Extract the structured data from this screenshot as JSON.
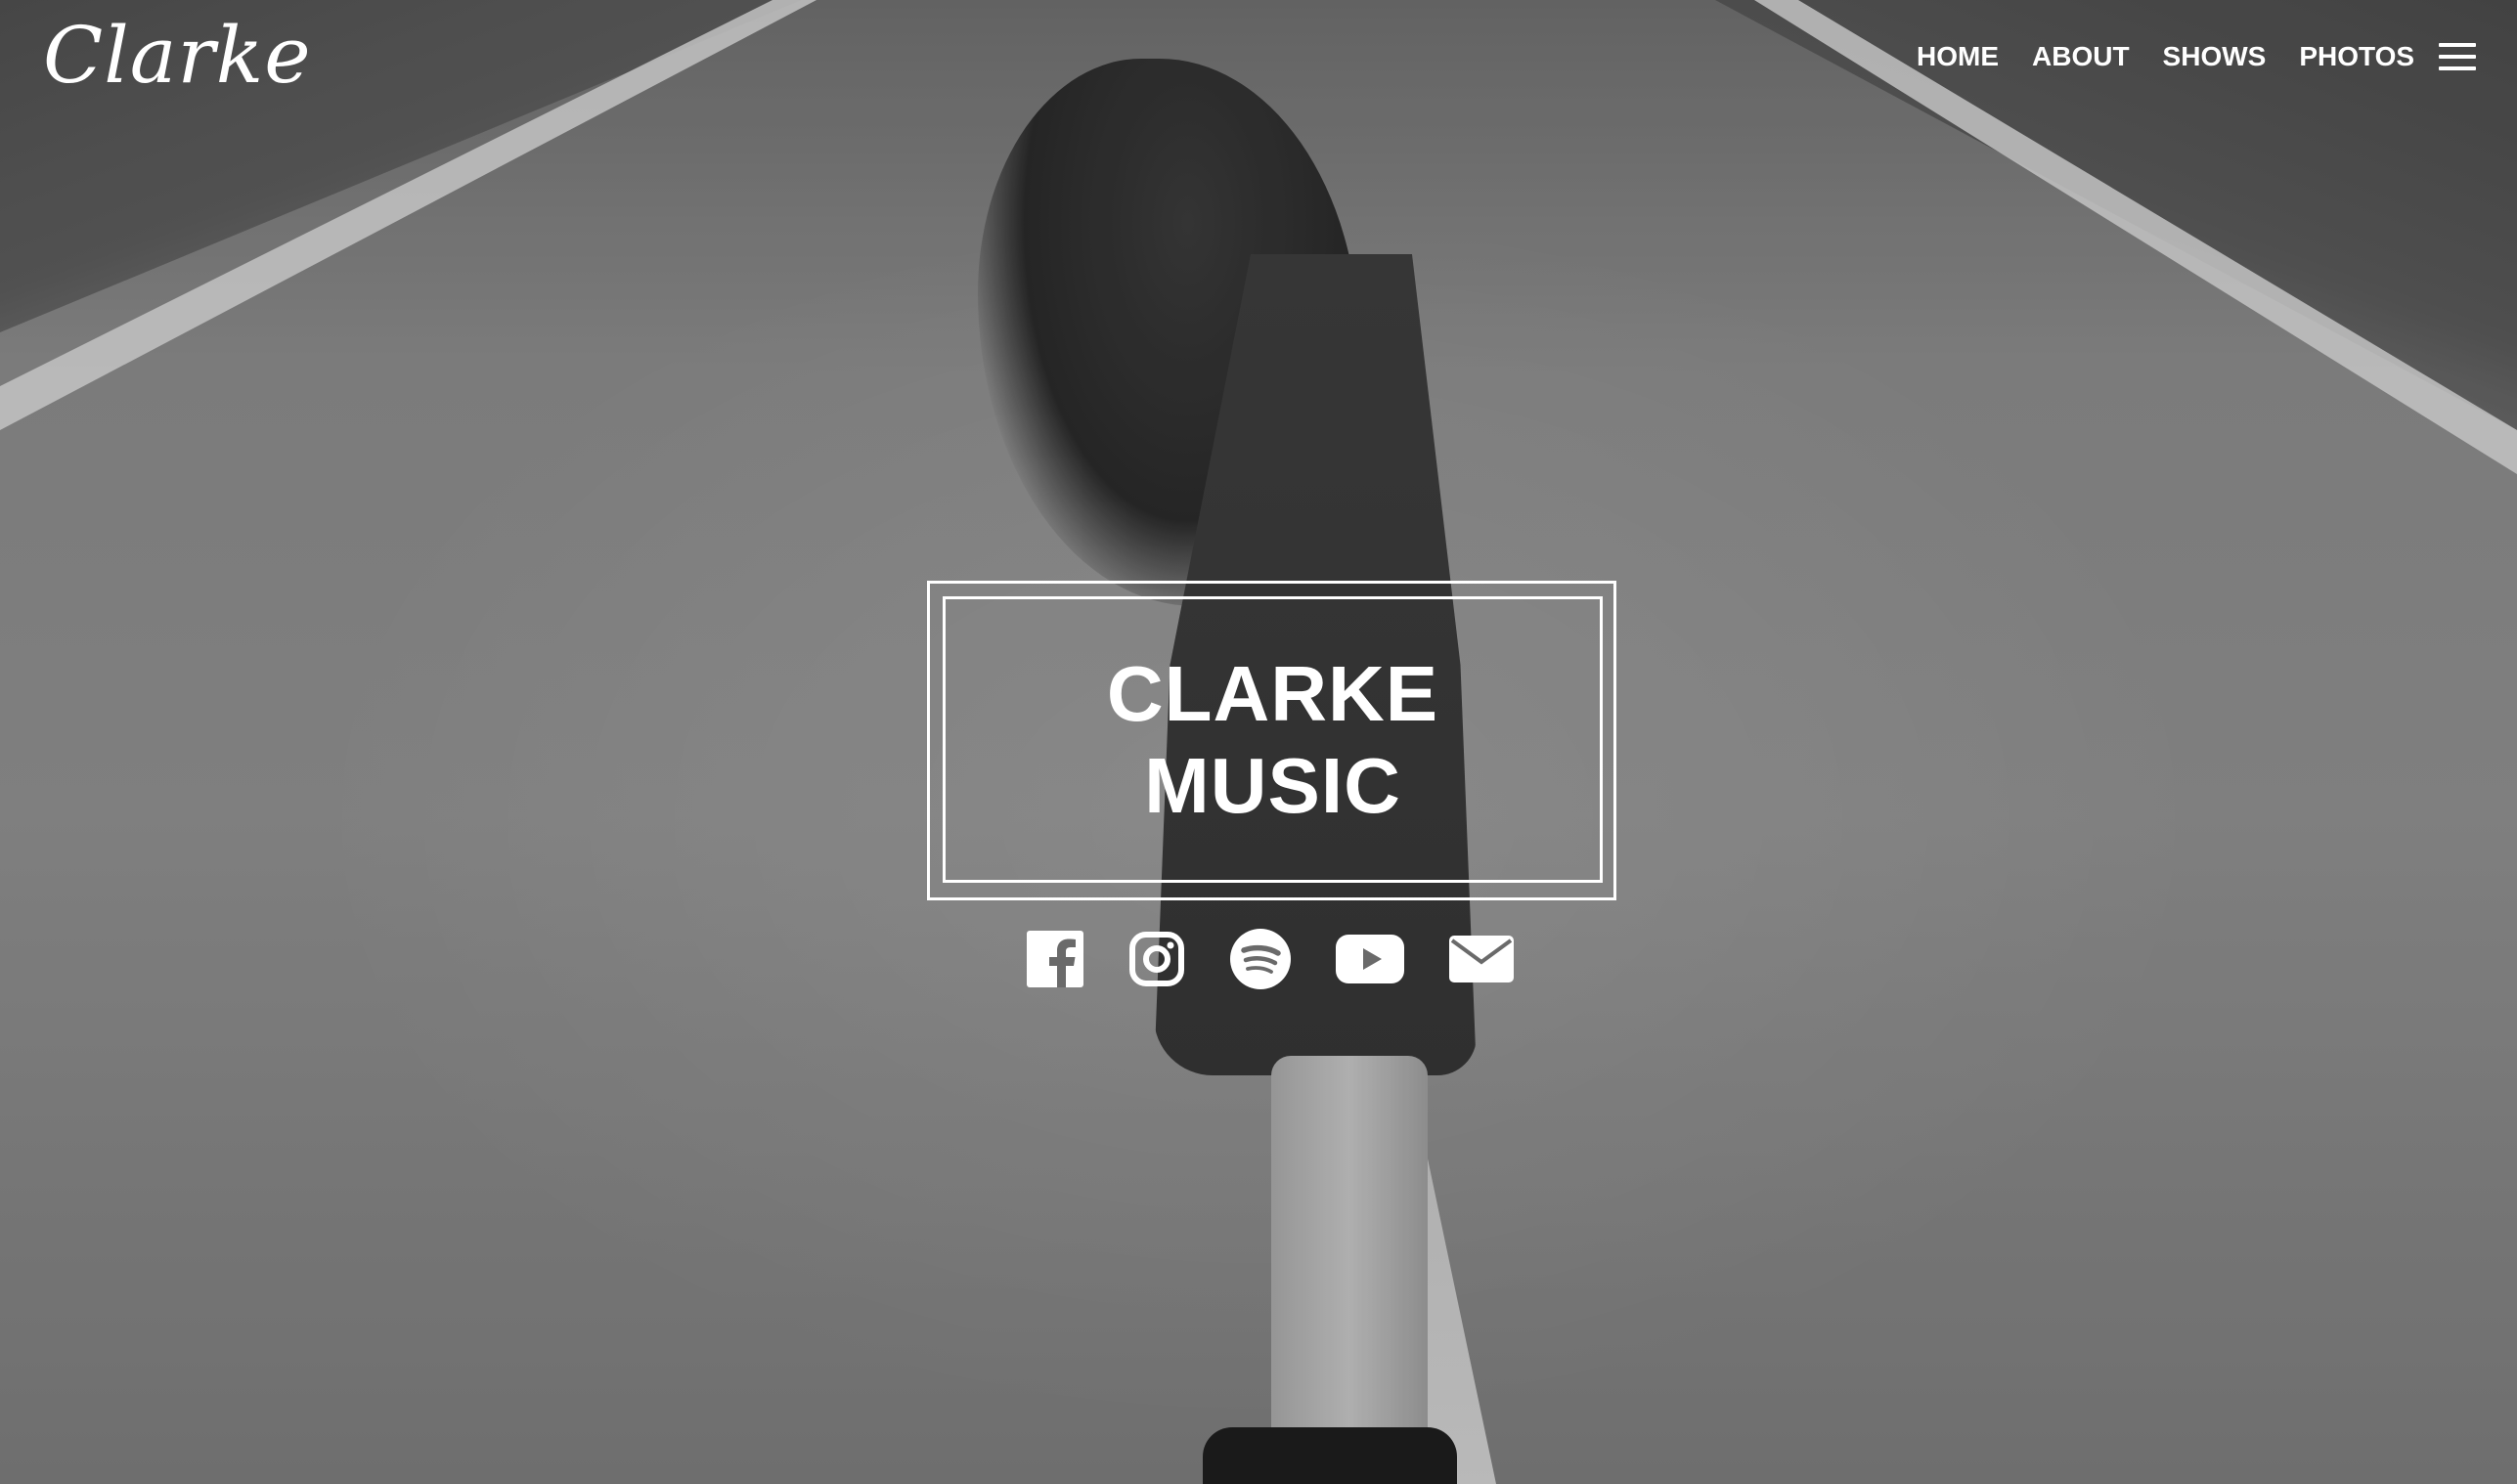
{
  "brand": {
    "logo_text": "Clarke"
  },
  "nav": {
    "items": [
      {
        "label": "HOME"
      },
      {
        "label": "ABOUT"
      },
      {
        "label": "SHOWS"
      },
      {
        "label": "PHOTOS"
      }
    ],
    "menu_icon": "hamburger-menu-icon"
  },
  "hero": {
    "title_line1": "CLARKE",
    "title_line2": "MUSIC",
    "background": "black-and-white photo of a woman standing on a road"
  },
  "social": [
    {
      "icon": "facebook-icon"
    },
    {
      "icon": "instagram-icon"
    },
    {
      "icon": "spotify-icon"
    },
    {
      "icon": "youtube-icon"
    },
    {
      "icon": "email-icon"
    }
  ],
  "colors": {
    "text": "#ffffff",
    "overlay": "#000000"
  }
}
